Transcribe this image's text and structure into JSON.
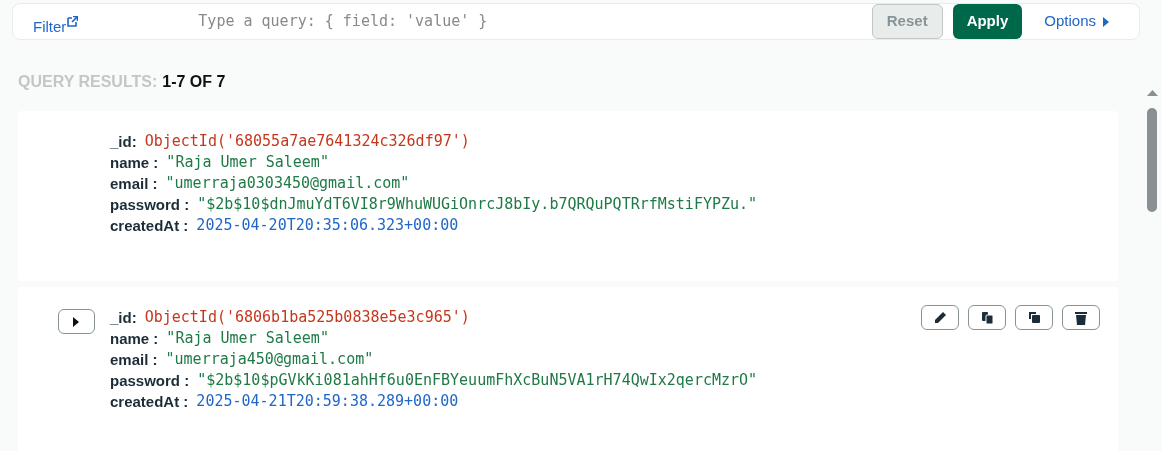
{
  "filter": {
    "label": "Filter",
    "placeholder": "Type a query: { field: 'value' }",
    "buttons": [
      {
        "label": "Reset",
        "kind": "secondary",
        "disabled": true
      },
      {
        "label": "Apply",
        "kind": "primary",
        "disabled": false
      }
    ],
    "options": "Options"
  },
  "results": {
    "label": "QUERY RESULTS:",
    "range": "1-7 OF 7"
  },
  "documents": [
    {
      "hovered": false,
      "fields": [
        {
          "key": "_id:",
          "kind": "objectid",
          "value": "ObjectId('68055a7ae7641324c326df97')"
        },
        {
          "key": "name :",
          "kind": "string",
          "value": "\"Raja Umer Saleem\""
        },
        {
          "key": "email :",
          "kind": "string",
          "value": "\"umerraja0303450@gmail.com\""
        },
        {
          "key": "password :",
          "kind": "string",
          "value": "\"$2b$10$dnJmuYdT6VI8r9WhuWUGiOnrcJ8bIy.b7QRQuPQTRrfMstiFYPZu.\""
        },
        {
          "key": "createdAt :",
          "kind": "date",
          "value": "2025-04-20T20:35:06.323+00:00"
        }
      ]
    },
    {
      "hovered": true,
      "fields": [
        {
          "key": "_id:",
          "kind": "objectid",
          "value": "ObjectId('6806b1ba525b0838e5e3c965')"
        },
        {
          "key": "name :",
          "kind": "string",
          "value": "\"Raja Umer Saleem\""
        },
        {
          "key": "email :",
          "kind": "string",
          "value": "\"umerraja450@gmail.com\""
        },
        {
          "key": "password :",
          "kind": "string",
          "value": "\"$2b$10$pGVkKi081ahHf6u0EnFBYeuumFhXcBuN5VA1rH74QwIx2qercMzrO\""
        },
        {
          "key": "createdAt :",
          "kind": "date",
          "value": "2025-04-21T20:59:38.289+00:00"
        }
      ]
    }
  ]
}
